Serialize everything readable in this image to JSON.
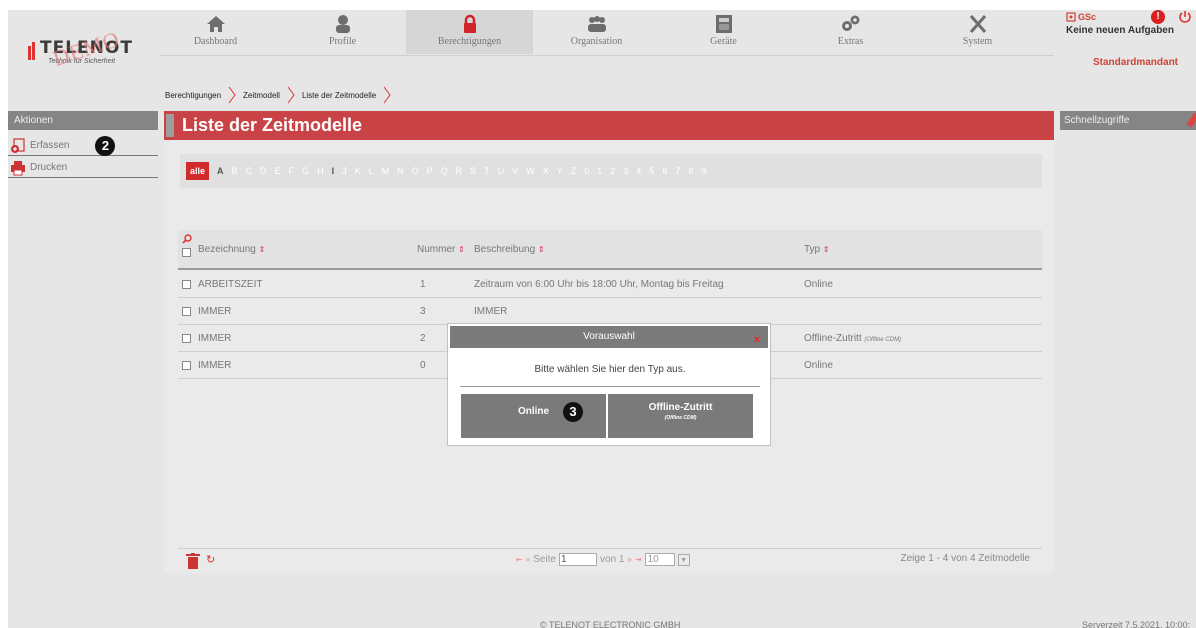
{
  "nav": {
    "items": [
      {
        "label": "Dashboard",
        "icon": "home-icon"
      },
      {
        "label": "Profile",
        "icon": "profile-icon"
      },
      {
        "label": "Berechtigungen",
        "icon": "lock-icon",
        "active": true
      },
      {
        "label": "Organisation",
        "icon": "people-icon"
      },
      {
        "label": "Geräte",
        "icon": "device-icon"
      },
      {
        "label": "Extras",
        "icon": "gears-icon"
      },
      {
        "label": "System",
        "icon": "tools-icon"
      }
    ]
  },
  "logo": {
    "brand": "TELENOT",
    "tagline": "Technik für Sicherheit",
    "watermark": "DEMO"
  },
  "user": {
    "initials": "GSc",
    "tasks": "Keine neuen Aufgaben",
    "mandant": "Standardmandant",
    "alert": "!"
  },
  "breadcrumb": [
    "Berechtigungen",
    "Zeitmodell",
    "Liste der Zeitmodelle"
  ],
  "sidebar": {
    "header": "Aktionen",
    "items": [
      {
        "label": "Erfassen",
        "icon": "add-document-icon"
      },
      {
        "label": "Drucken",
        "icon": "printer-icon"
      }
    ]
  },
  "badges": {
    "two": "2",
    "three": "3"
  },
  "main": {
    "title": "Liste der Zeitmodelle",
    "alpha_all": "alle",
    "letters": [
      "A",
      "B",
      "C",
      "D",
      "E",
      "F",
      "G",
      "H",
      "I",
      "J",
      "K",
      "L",
      "M",
      "N",
      "O",
      "P",
      "Q",
      "R",
      "S",
      "T",
      "U",
      "V",
      "W",
      "X",
      "Y",
      "Z",
      "0",
      "1",
      "2",
      "3",
      "4",
      "5",
      "6",
      "7",
      "8",
      "9"
    ],
    "columns": {
      "name": "Bezeichnung",
      "number": "Nummer",
      "desc": "Beschreibung",
      "type": "Typ"
    },
    "rows": [
      {
        "name": "ARBEITSZEIT",
        "number": "1",
        "desc": "Zeitraum von 6:00 Uhr bis 18:00 Uhr, Montag bis Freitag",
        "type": "Online",
        "type_sub": ""
      },
      {
        "name": "IMMER",
        "number": "3",
        "desc": "IMMER",
        "type": "",
        "type_sub": ""
      },
      {
        "name": "IMMER",
        "number": "2",
        "desc": "",
        "type": "Offline-Zutritt",
        "type_sub": "(Offline CDM)"
      },
      {
        "name": "IMMER",
        "number": "0",
        "desc": "",
        "type": "Online",
        "type_sub": ""
      }
    ],
    "pager": {
      "page_label": "Seite",
      "page_value": "1",
      "of_label": "von 1",
      "page_size": "10",
      "info": "Zeige 1 - 4 von 4 Zeitmodelle"
    }
  },
  "right_sidebar": {
    "header": "Schnellzugriffe"
  },
  "modal": {
    "title": "Vorauswahl",
    "close": "×",
    "text": "Bitte wählen Sie hier den Typ aus.",
    "btn_online": "Online",
    "btn_offline": "Offline-Zutritt",
    "btn_offline_sub": "(Offline CDM)"
  },
  "footer": {
    "copyright": "© TELENOT ELECTRONIC GMBH",
    "server": "Serverzeit 7.5.2021, 10:00:"
  },
  "colors": {
    "accent": "#c94246",
    "sidebar_header": "#858585"
  }
}
